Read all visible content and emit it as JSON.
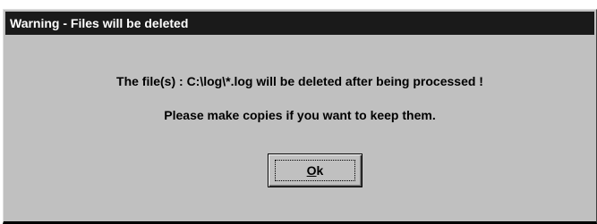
{
  "dialog": {
    "title": "Warning - Files will be deleted",
    "message_line1": "The file(s) : C:\\log\\*.log will be deleted after being processed !",
    "message_line2": "Please make copies if you want to keep them.",
    "ok_button": {
      "mnemonic": "O",
      "rest": "k"
    }
  }
}
